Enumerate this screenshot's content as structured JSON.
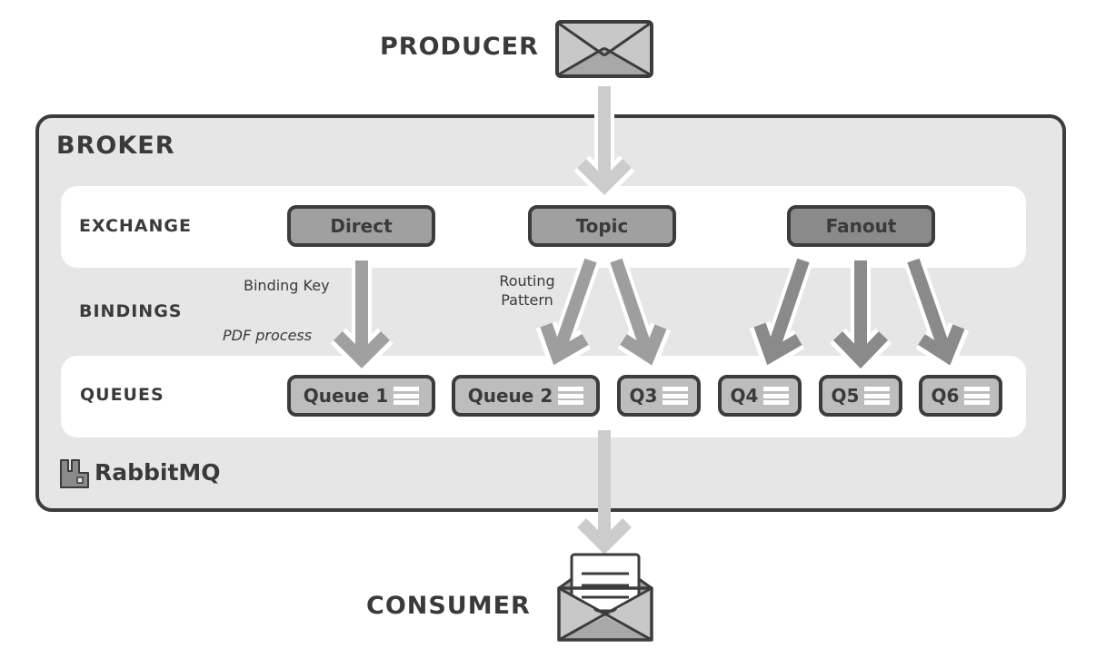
{
  "producer": {
    "label": "PRODUCER",
    "icon": "envelope-closed-icon"
  },
  "consumer": {
    "label": "CONSUMER",
    "icon": "envelope-open-letter-icon"
  },
  "broker": {
    "title": "BROKER",
    "rows": {
      "exchange": "EXCHANGE",
      "bindings": "BINDINGS",
      "queues": "QUEUES"
    },
    "exchanges": [
      {
        "label": "Direct",
        "shade": "#a0a0a0"
      },
      {
        "label": "Topic",
        "shade": "#a0a0a0"
      },
      {
        "label": "Fanout",
        "shade": "#8a8a8a"
      }
    ],
    "binding_labels": {
      "binding_key": "Binding Key",
      "binding_key_value": "PDF process",
      "routing_line1": "Routing",
      "routing_line2": "Pattern"
    },
    "queues": [
      {
        "label": "Queue 1"
      },
      {
        "label": "Queue 2"
      },
      {
        "label": "Q3"
      },
      {
        "label": "Q4"
      },
      {
        "label": "Q5"
      },
      {
        "label": "Q6"
      }
    ],
    "logo": {
      "text": "RabbitMQ",
      "icon": "rabbitmq-logo-icon"
    }
  },
  "colors": {
    "outline": "#3c3c3c",
    "broker_bg": "#e6e6e6",
    "flow_arrow": "#cccccc",
    "topic_arrow": "#9e9e9e",
    "fanout_arrow": "#8a8a8a"
  }
}
